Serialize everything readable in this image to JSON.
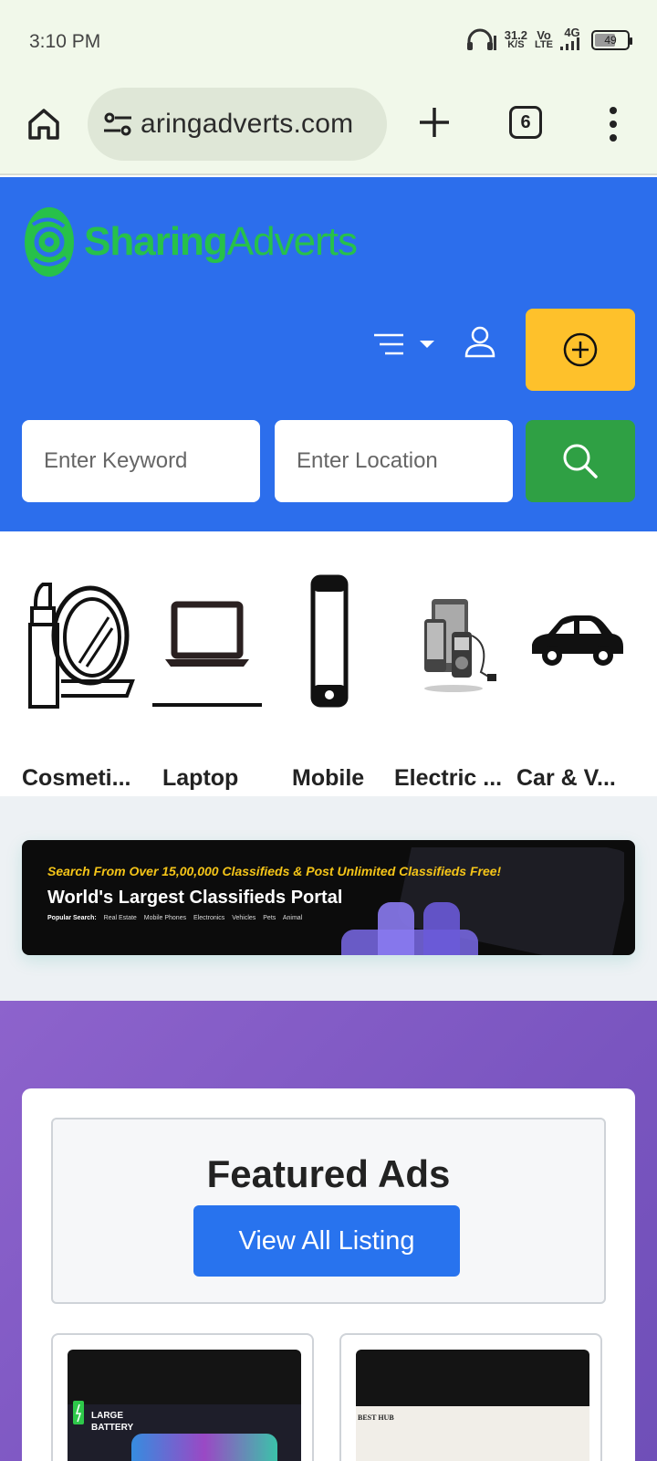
{
  "status_bar": {
    "time": "3:10 PM",
    "net_speed": "31.2",
    "net_unit": "K/S",
    "volte_top": "Vo",
    "volte_bottom": "LTE",
    "network": "4G",
    "battery": "49"
  },
  "browser": {
    "url": "aringadverts.com",
    "tab_count": "6"
  },
  "site": {
    "logo_bold": "Sharing",
    "logo_light": "Adverts",
    "colors": {
      "header_bg": "#2c6eec",
      "post_button": "#fec12b",
      "search_button": "#2fa044",
      "logo": "#27c14a"
    }
  },
  "search": {
    "keyword_placeholder": "Enter Keyword",
    "location_placeholder": "Enter Location"
  },
  "categories": [
    {
      "label": "Cosmeti...",
      "icon": "cosmetics-icon"
    },
    {
      "label": "Laptop",
      "icon": "laptop-icon"
    },
    {
      "label": "Mobile",
      "icon": "mobile-icon"
    },
    {
      "label": "Electric ...",
      "icon": "electronics-icon"
    },
    {
      "label": "Car & V...",
      "icon": "car-icon"
    }
  ],
  "banner": {
    "tagline": "Search From Over 15,00,000 Classifieds & Post Unlimited Classifieds Free!",
    "title": "World's Largest Classifieds Portal",
    "popular_label": "Popular Search:",
    "popular": [
      "Real Estate",
      "Mobile Phones",
      "Electronics",
      "Vehicles",
      "Pets",
      "Animal"
    ]
  },
  "featured": {
    "title": "Featured Ads",
    "button": "View All Listing",
    "ad1_badge_top": "LARGE",
    "ad1_badge_bottom": "BATTERY",
    "ad2_brand": "BEST HUB"
  }
}
